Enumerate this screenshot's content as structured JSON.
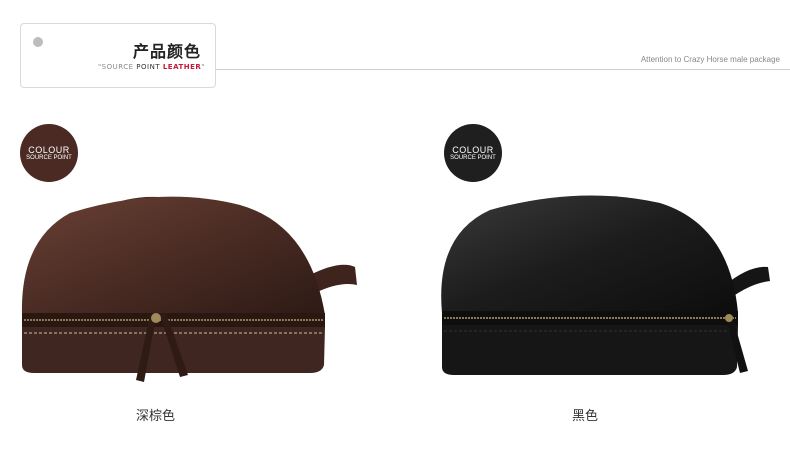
{
  "header": {
    "title_cn": "产品颜色",
    "subtitle_prefix": "\"SOURCE ",
    "subtitle_point": "POINT ",
    "subtitle_leather": "LEATHER",
    "subtitle_suffix": "\"",
    "note": "Attention to Crazy Horse male package"
  },
  "products": [
    {
      "badge_line1": "COLOUR",
      "badge_line2": "SOURCE POINT",
      "badge_color": "#4a2a22",
      "bag_color": "#4a2c24",
      "caption": "深棕色"
    },
    {
      "badge_line1": "COLOUR",
      "badge_line2": "SOURCE POINT",
      "badge_color": "#1f1f1f",
      "bag_color": "#1a1a1a",
      "caption": "黑色"
    }
  ]
}
